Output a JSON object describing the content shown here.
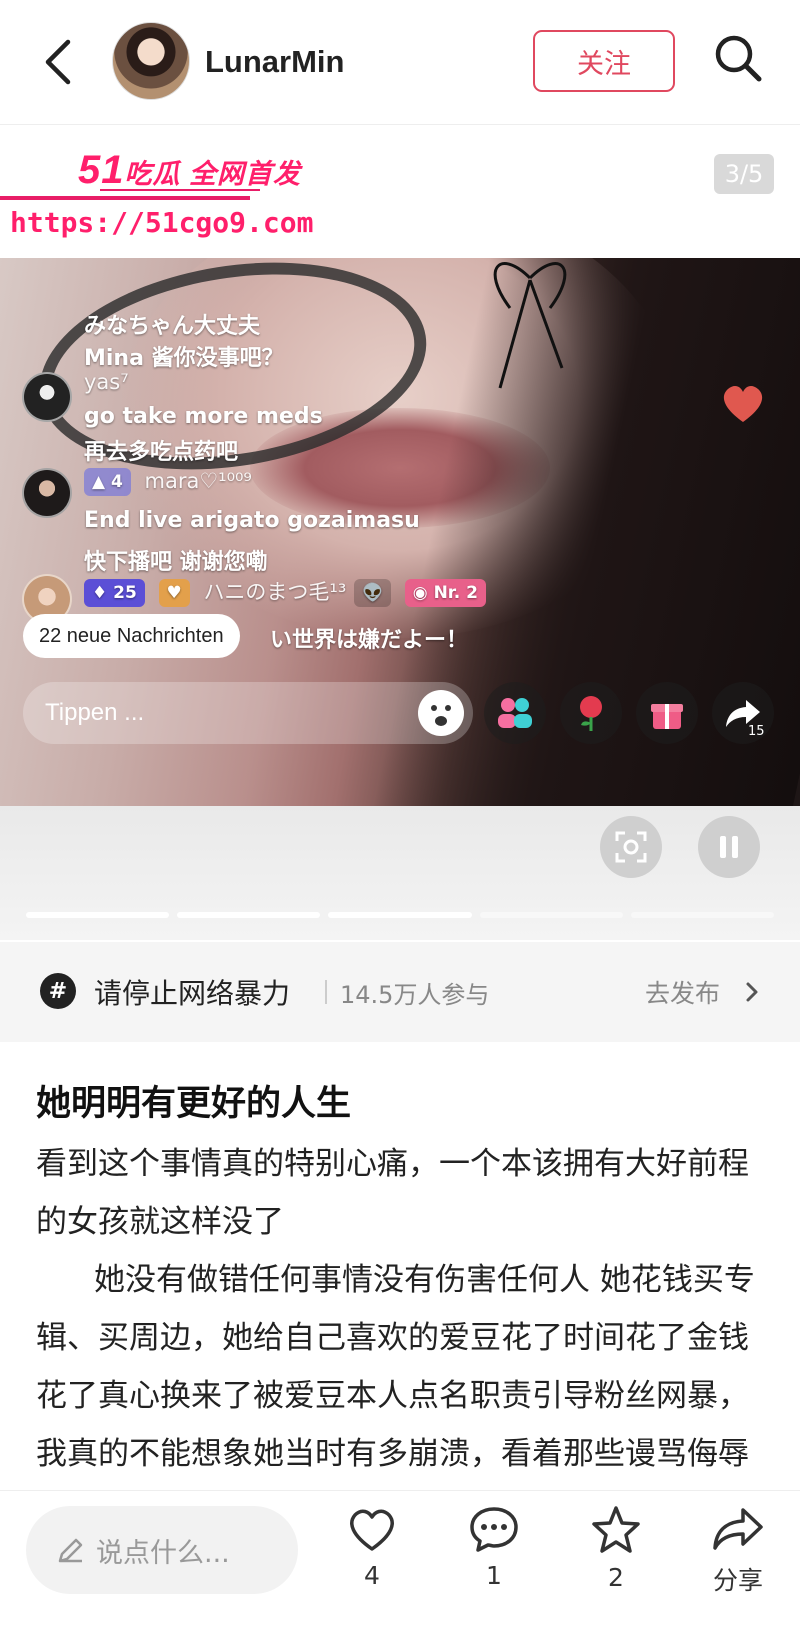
{
  "header": {
    "username": "LunarMin",
    "follow_label": "关注"
  },
  "media": {
    "watermark_title_num": "51",
    "watermark_title_text": "吃瓜 全网首发",
    "watermark_url": "https://51cgo9.com",
    "page_counter": "3/5",
    "chat": [
      {
        "text": "みなちゃん大丈夫"
      },
      {
        "text": "Mina 酱你没事吧？"
      },
      {
        "user": "yas⁷"
      },
      {
        "text": "go take more meds"
      },
      {
        "text": "再去多吃点药吧"
      },
      {
        "badge": "4",
        "user": "mara♡¹⁰⁰⁹"
      },
      {
        "text": "End live arigato gozaimasu"
      },
      {
        "text": "快下播吧 谢谢您嘞"
      },
      {
        "badge1": "25",
        "user": "ハニのまつ毛¹³",
        "badge3": "Nr. 2"
      },
      {
        "text": "い世界は嫌だよー！"
      }
    ],
    "notice_pill": "22 neue Nachrichten",
    "input_placeholder": "Tippen ...",
    "share_count": "15",
    "progress_total": 5,
    "progress_current": 3
  },
  "topic": {
    "name": "请停止网络暴力",
    "count": "14.5万人参与",
    "go_label": "去发布"
  },
  "post": {
    "title": "她明明有更好的人生",
    "para1": "看到这个事情真的特别心痛，一个本该拥有大好前程的女孩就这样没了",
    "para2": "她没有做错任何事情没有伤害任何人 她花钱买专辑、买周边，她给自己喜欢的爱豆花了时间花了金钱花了真心换来了被爱豆本人点名职责引导粉丝网暴，我真的不能想象她当时有多崩溃，看着那些谩骂侮辱的评论你又有得什么"
  },
  "bottom": {
    "comment_placeholder": "说点什么...",
    "like_count": "4",
    "comment_count": "1",
    "star_count": "2",
    "share_label": "分享"
  },
  "colors": {
    "accent": "#e0485f",
    "watermark": "#ff1f6b"
  }
}
